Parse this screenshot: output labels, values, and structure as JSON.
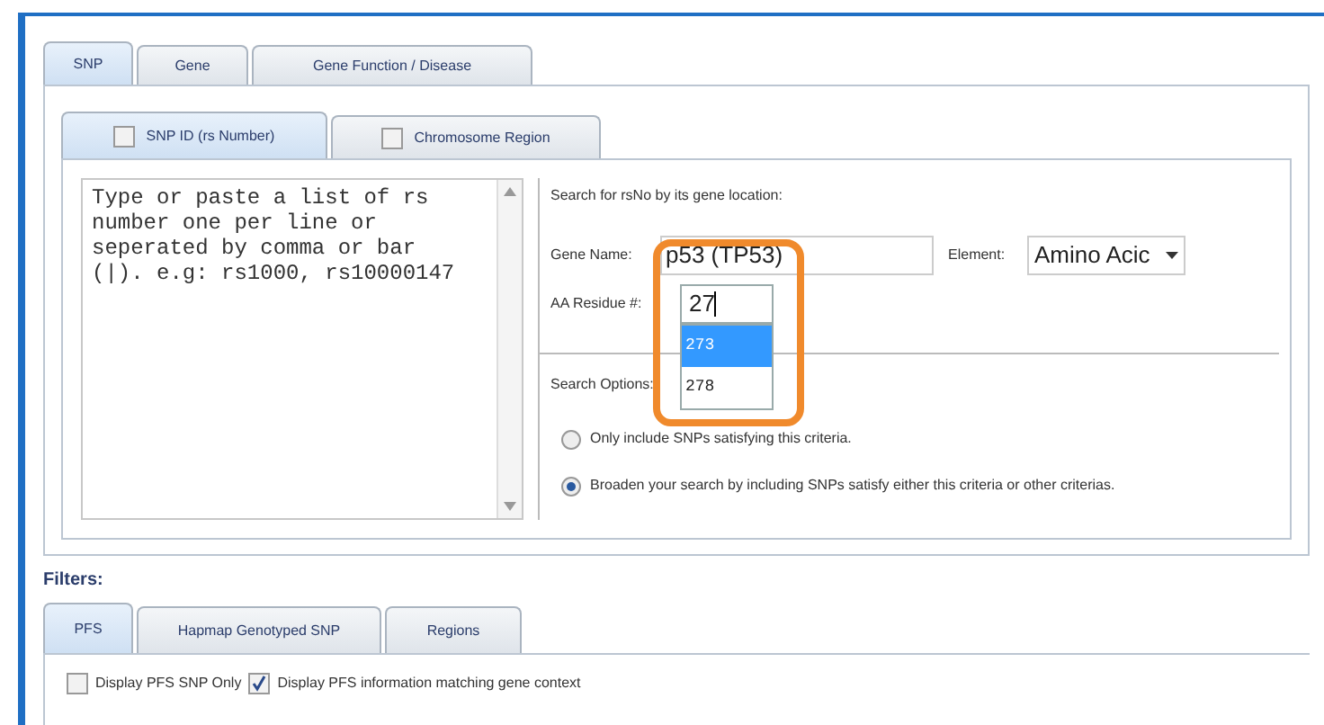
{
  "main_tabs": [
    {
      "label": "SNP",
      "selected": true
    },
    {
      "label": "Gene",
      "selected": false
    },
    {
      "label": "Gene Function / Disease",
      "selected": false
    }
  ],
  "sub_tabs": [
    {
      "label": "SNP ID (rs Number)",
      "selected": true,
      "checked": false
    },
    {
      "label": "Chromosome Region",
      "selected": false,
      "checked": false
    }
  ],
  "rs_list": {
    "placeholder": "Type or paste a list of rs number one per line or seperated by comma or bar (|). e.g: rs1000, rs10000147"
  },
  "location": {
    "heading": "Search for rsNo by its gene location:",
    "gene_name_label": "Gene Name:",
    "gene_name": "p53 (TP53)",
    "element_label": "Element:",
    "element": "Amino Acic",
    "aa_residue_label": "AA Residue #:",
    "aa_residue": "27",
    "suggestions": [
      {
        "label": "273",
        "selected": true
      },
      {
        "label": "278",
        "selected": false
      }
    ]
  },
  "search_options": {
    "label": "Search Options:",
    "options": [
      {
        "label": "Only include SNPs satisfying this criteria.",
        "selected": false
      },
      {
        "label": "Broaden your search by including SNPs satisfy either this criteria or other criterias.",
        "selected": true
      }
    ]
  },
  "filters": {
    "label": "Filters:",
    "tabs": [
      {
        "label": "PFS",
        "selected": true
      },
      {
        "label": "Hapmap Genotyped SNP",
        "selected": false
      },
      {
        "label": "Regions",
        "selected": false
      }
    ],
    "checks": [
      {
        "label": "Display PFS SNP Only",
        "checked": false
      },
      {
        "label": "Display PFS information matching gene context",
        "checked": true
      }
    ]
  }
}
